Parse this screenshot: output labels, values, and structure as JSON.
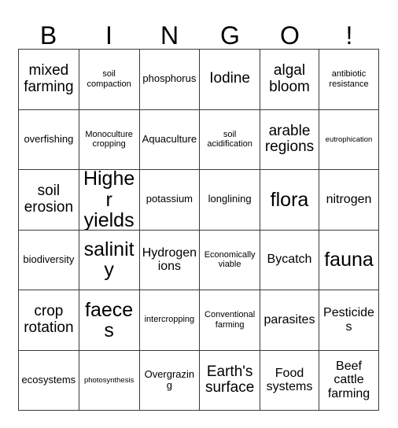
{
  "card": {
    "title": "BINGO Card",
    "header_letters": [
      "B",
      "I",
      "N",
      "G",
      "O",
      "!"
    ],
    "columns": 6,
    "rows": 6,
    "grid": [
      [
        {
          "text": "mixed farming",
          "size": "fs-xl"
        },
        {
          "text": "soil compaction",
          "size": "fs-s"
        },
        {
          "text": "phosphorus",
          "size": "fs-m"
        },
        {
          "text": "Iodine",
          "size": "fs-xl"
        },
        {
          "text": "algal bloom",
          "size": "fs-xl"
        },
        {
          "text": "antibiotic resistance",
          "size": "fs-s"
        }
      ],
      [
        {
          "text": "overfishing",
          "size": "fs-m"
        },
        {
          "text": "Monoculture cropping",
          "size": "fs-s"
        },
        {
          "text": "Aquaculture",
          "size": "fs-m"
        },
        {
          "text": "soil acidification",
          "size": "fs-s"
        },
        {
          "text": "arable regions",
          "size": "fs-xl"
        },
        {
          "text": "eutrophication",
          "size": "fs-xs"
        }
      ],
      [
        {
          "text": "soil erosion",
          "size": "fs-xl"
        },
        {
          "text": "Higher yields",
          "size": "fs-xxl"
        },
        {
          "text": "potassium",
          "size": "fs-m"
        },
        {
          "text": "longlining",
          "size": "fs-m"
        },
        {
          "text": "flora",
          "size": "fs-xxl"
        },
        {
          "text": "nitrogen",
          "size": "fs-l"
        }
      ],
      [
        {
          "text": "biodiversity",
          "size": "fs-m"
        },
        {
          "text": "salinity",
          "size": "fs-xxl"
        },
        {
          "text": "Hydrogen ions",
          "size": "fs-l"
        },
        {
          "text": "Economically viable",
          "size": "fs-s"
        },
        {
          "text": "Bycatch",
          "size": "fs-l"
        },
        {
          "text": "fauna",
          "size": "fs-xxl"
        }
      ],
      [
        {
          "text": "crop rotation",
          "size": "fs-xl"
        },
        {
          "text": "faeces",
          "size": "fs-xxl"
        },
        {
          "text": "intercropping",
          "size": "fs-s"
        },
        {
          "text": "Conventional farming",
          "size": "fs-s"
        },
        {
          "text": "parasites",
          "size": "fs-l"
        },
        {
          "text": "Pesticides",
          "size": "fs-l"
        }
      ],
      [
        {
          "text": "ecosystems",
          "size": "fs-m"
        },
        {
          "text": "photosynthesis",
          "size": "fs-xs"
        },
        {
          "text": "Overgrazing",
          "size": "fs-m"
        },
        {
          "text": "Earth's surface",
          "size": "fs-xl"
        },
        {
          "text": "Food systems",
          "size": "fs-l"
        },
        {
          "text": "Beef cattle farming",
          "size": "fs-l"
        }
      ]
    ]
  },
  "colors": {
    "background": "#ffffff",
    "border": "#3a3a3a",
    "text": "#000000"
  }
}
